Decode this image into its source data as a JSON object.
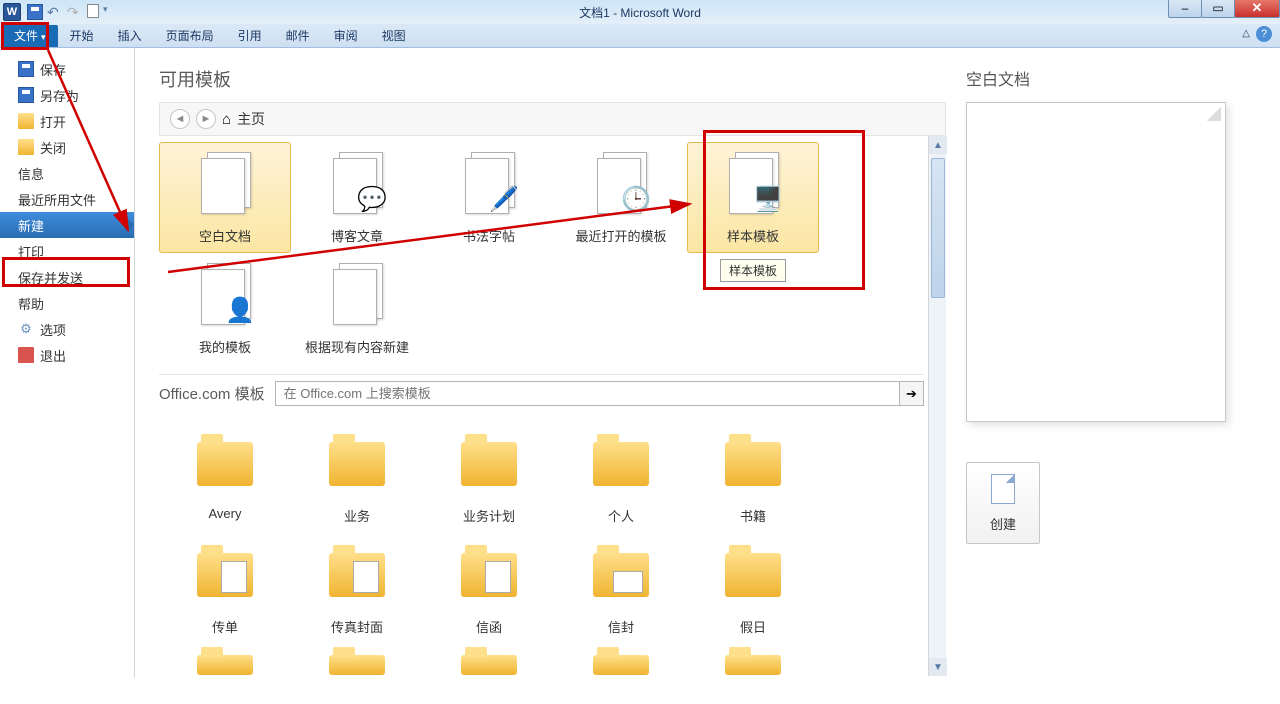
{
  "title": "文档1 - Microsoft Word",
  "tabs": {
    "file": "文件",
    "home": "开始",
    "insert": "插入",
    "layout": "页面布局",
    "ref": "引用",
    "mail": "邮件",
    "review": "审阅",
    "view": "视图"
  },
  "sidebar": {
    "save": "保存",
    "saveas": "另存为",
    "open": "打开",
    "close": "关闭",
    "info": "信息",
    "recent": "最近所用文件",
    "new": "新建",
    "print": "打印",
    "saveSend": "保存并发送",
    "help": "帮助",
    "options": "选项",
    "exit": "退出"
  },
  "center": {
    "heading": "可用模板",
    "home": "主页",
    "templates": {
      "blank": "空白文档",
      "blog": "博客文章",
      "calligraphy": "书法字帖",
      "recent": "最近打开的模板",
      "sample": "样本模板",
      "sample_tooltip": "样本模板",
      "my": "我的模板",
      "fromExisting": "根据现有内容新建"
    },
    "officecom": "Office.com 模板",
    "search_placeholder": "在 Office.com 上搜索模板",
    "categories": {
      "avery": "Avery",
      "business": "业务",
      "bizplan": "业务计划",
      "personal": "个人",
      "books": "书籍",
      "flyers": "传单",
      "fax": "传真封面",
      "letters": "信函",
      "envelopes": "信封",
      "holidays": "假日"
    }
  },
  "preview": {
    "title": "空白文档",
    "create": "创建"
  }
}
